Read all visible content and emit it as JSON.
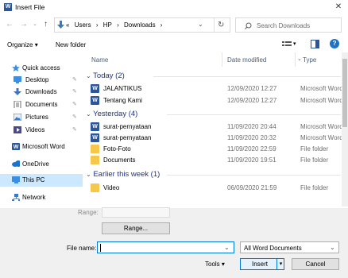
{
  "window": {
    "title": "Insert File",
    "close_glyph": "✕"
  },
  "nav": {
    "back": "←",
    "forward": "→",
    "up": "↑"
  },
  "address": {
    "crumbs": [
      "«",
      "Users",
      "›",
      "HP",
      "›",
      "Downloads",
      "›"
    ],
    "chevron": "⌄",
    "refresh": "↻"
  },
  "search": {
    "placeholder": "Search Downloads"
  },
  "toolbar": {
    "organize": "Organize",
    "new_folder": "New folder",
    "help": "?"
  },
  "sidebar": {
    "quick_access": "Quick access",
    "items": [
      {
        "label": "Desktop",
        "pinned": true
      },
      {
        "label": "Downloads",
        "pinned": true
      },
      {
        "label": "Documents",
        "pinned": true
      },
      {
        "label": "Pictures",
        "pinned": true
      },
      {
        "label": "Videos",
        "pinned": true
      },
      {
        "label": "Microsoft Word"
      },
      {
        "label": "OneDrive"
      },
      {
        "label": "This PC"
      },
      {
        "label": "Network"
      }
    ],
    "pin_glyph": "✎"
  },
  "columns": {
    "name": "Name",
    "date": "Date modified",
    "type": "Type"
  },
  "groups": [
    {
      "label": "Today (2)"
    },
    {
      "label": "Yesterday (4)"
    },
    {
      "label": "Earlier this week (1)"
    }
  ],
  "files": [
    {
      "name": "JALANTIKUS",
      "date": "12/09/2020 12:27",
      "type": "Microsoft Word D",
      "icon": "word"
    },
    {
      "name": "Tentang Kami",
      "date": "12/09/2020 12:27",
      "type": "Microsoft Word D",
      "icon": "word"
    },
    {
      "name": "surat-pernyataan",
      "date": "11/09/2020 20:44",
      "type": "Microsoft Word D",
      "icon": "word"
    },
    {
      "name": "surat-pernyataan",
      "date": "11/09/2020 20:32",
      "type": "Microsoft Word D",
      "icon": "word"
    },
    {
      "name": "Foto-Foto",
      "date": "11/09/2020 22:59",
      "type": "File folder",
      "icon": "folder"
    },
    {
      "name": "Documents",
      "date": "11/09/2020 19:51",
      "type": "File folder",
      "icon": "folder"
    },
    {
      "name": "Video",
      "date": "06/09/2020 21:59",
      "type": "File folder",
      "icon": "folder"
    }
  ],
  "range": {
    "label": "Range:",
    "button": "Range..."
  },
  "filename": {
    "label": "File name:",
    "value": ""
  },
  "filetype": {
    "selected": "All Word Documents"
  },
  "buttons": {
    "tools": "Tools",
    "insert": "Insert",
    "cancel": "Cancel"
  },
  "colors": {
    "accent": "#0078d7",
    "selection": "#cce8ff",
    "group_text": "#1e3287"
  }
}
